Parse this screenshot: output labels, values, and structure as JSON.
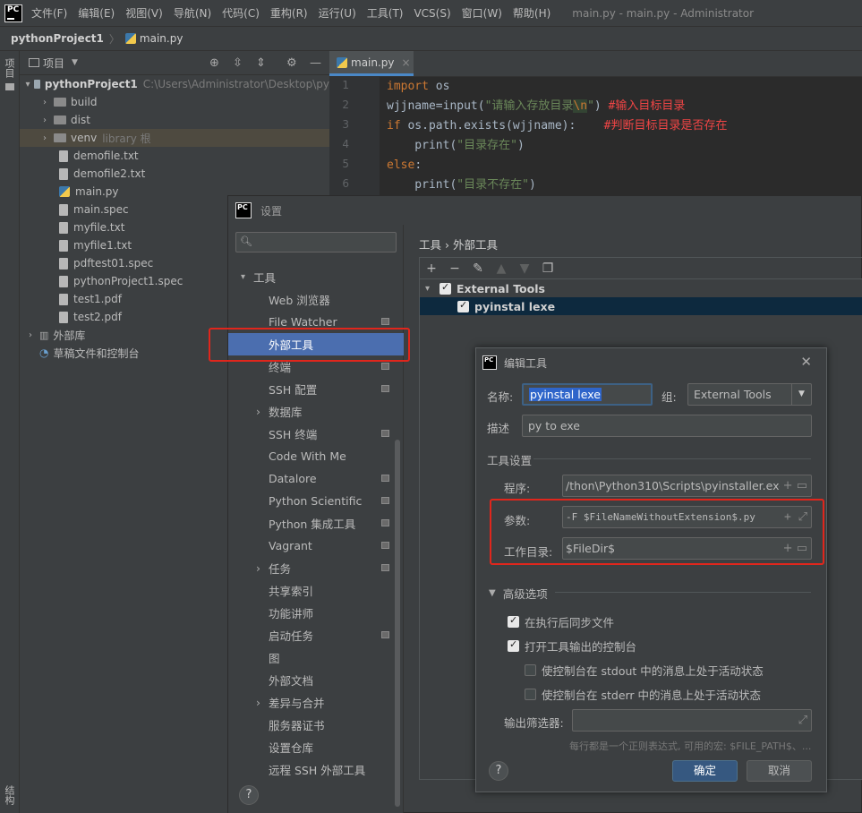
{
  "menubar": {
    "items": [
      "文件(F)",
      "编辑(E)",
      "视图(V)",
      "导航(N)",
      "代码(C)",
      "重构(R)",
      "运行(U)",
      "工具(T)",
      "VCS(S)",
      "窗口(W)",
      "帮助(H)"
    ],
    "window_title": "main.py - main.py - Administrator"
  },
  "navbar": {
    "project": "pythonProject1",
    "file": "main.py"
  },
  "stripe": {
    "top_tab": "项目",
    "bottom_tab": "结构"
  },
  "project_panel": {
    "title": "项目",
    "root": {
      "name": "pythonProject1",
      "path": "C:\\Users\\Administrator\\Desktop\\py"
    },
    "items": [
      {
        "name": "build",
        "kind": "folder"
      },
      {
        "name": "dist",
        "kind": "folder"
      },
      {
        "name": "venv",
        "suffix": "library 根",
        "kind": "folder"
      },
      {
        "name": "demofile.txt",
        "kind": "file"
      },
      {
        "name": "demofile2.txt",
        "kind": "file"
      },
      {
        "name": "main.py",
        "kind": "py"
      },
      {
        "name": "main.spec",
        "kind": "file"
      },
      {
        "name": "myfile.txt",
        "kind": "file"
      },
      {
        "name": "myfile1.txt",
        "kind": "file"
      },
      {
        "name": "pdftest01.spec",
        "kind": "file"
      },
      {
        "name": "pythonProject1.spec",
        "kind": "file"
      },
      {
        "name": "test1.pdf",
        "kind": "file"
      },
      {
        "name": "test2.pdf",
        "kind": "file"
      }
    ],
    "external_libs": "外部库",
    "scratches": "草稿文件和控制台"
  },
  "editor": {
    "tab": "main.py",
    "line_numbers": [
      "1",
      "2",
      "3",
      "4",
      "5",
      "6"
    ],
    "lines": {
      "l1_kw": "import",
      "l1_rest": " os",
      "l2_a": "wjjname=input(",
      "l2_str": "\"请输入存放目录",
      "l2_esc": "\\n",
      "l2_strend": "\"",
      "l2_close": ") ",
      "l2_cmt": "#输入目标目录",
      "l3_kw": "if",
      "l3_rest": " os.path.exists(wjjname):    ",
      "l3_cmt": "#判断目标目录是否存在",
      "l4_fn": "    print(",
      "l4_str": "\"目录存在\"",
      "l4_close": ")",
      "l5_kw": "else",
      "l5_rest": ":",
      "l6_fn": "    print(",
      "l6_str": "\"目录不存在\"",
      "l6_close": ")"
    }
  },
  "settings": {
    "title": "设置",
    "breadcrumb": "工具  ›  外部工具",
    "sidebar": [
      {
        "label": "工具",
        "level": 0,
        "expanded": true
      },
      {
        "label": "Web 浏览器",
        "level": 1
      },
      {
        "label": "File Watcher",
        "level": 1,
        "badge": true
      },
      {
        "label": "外部工具",
        "level": 1,
        "selected": true
      },
      {
        "label": "终端",
        "level": 1,
        "badge": true
      },
      {
        "label": "SSH 配置",
        "level": 1,
        "badge": true
      },
      {
        "label": "数据库",
        "level": 1,
        "arrow": true
      },
      {
        "label": "SSH 终端",
        "level": 1,
        "badge": true
      },
      {
        "label": "Code With Me",
        "level": 1
      },
      {
        "label": "Datalore",
        "level": 1,
        "badge": true
      },
      {
        "label": "Python Scientific",
        "level": 1,
        "badge": true
      },
      {
        "label": "Python 集成工具",
        "level": 1,
        "badge": true
      },
      {
        "label": "Vagrant",
        "level": 1,
        "badge": true
      },
      {
        "label": "任务",
        "level": 1,
        "arrow": true,
        "badge": true
      },
      {
        "label": "共享索引",
        "level": 1
      },
      {
        "label": "功能讲师",
        "level": 1
      },
      {
        "label": "启动任务",
        "level": 1,
        "badge": true
      },
      {
        "label": "图",
        "level": 1
      },
      {
        "label": "外部文档",
        "level": 1
      },
      {
        "label": "差异与合并",
        "level": 1,
        "arrow": true
      },
      {
        "label": "服务器证书",
        "level": 1
      },
      {
        "label": "设置仓库",
        "level": 1
      },
      {
        "label": "远程 SSH 外部工具",
        "level": 1
      }
    ],
    "toolbar": [
      "+",
      "−",
      "✎",
      "▲",
      "▼",
      "❐"
    ],
    "tree": {
      "group": "External Tools",
      "tool": "pyinstal lexe"
    },
    "help": "?"
  },
  "edit_tool": {
    "title": "编辑工具",
    "name_label": "名称:",
    "name_value": "pyinstal lexe",
    "group_label": "组:",
    "group_value": "External Tools",
    "desc_label": "描述",
    "desc_value": "py to exe",
    "tool_settings": "工具设置",
    "program_label": "程序:",
    "program_value": "/thon\\Python310\\Scripts\\pyinstaller.exe",
    "args_label": "参数:",
    "args_value": "-F $FileNameWithoutExtension$.py",
    "workdir_label": "工作目录:",
    "workdir_value": "$FileDir$",
    "advanced": "高级选项",
    "opt_sync": "在执行后同步文件",
    "opt_console": "打开工具输出的控制台",
    "opt_stdout": "使控制台在 stdout 中的消息上处于活动状态",
    "opt_stderr": "使控制台在 stderr 中的消息上处于活动状态",
    "filter_label": "输出筛选器:",
    "filter_hint": "每行都是一个正则表达式, 可用的宏: $FILE_PATH$、...",
    "ok": "确定",
    "cancel": "取消",
    "help": "?"
  }
}
